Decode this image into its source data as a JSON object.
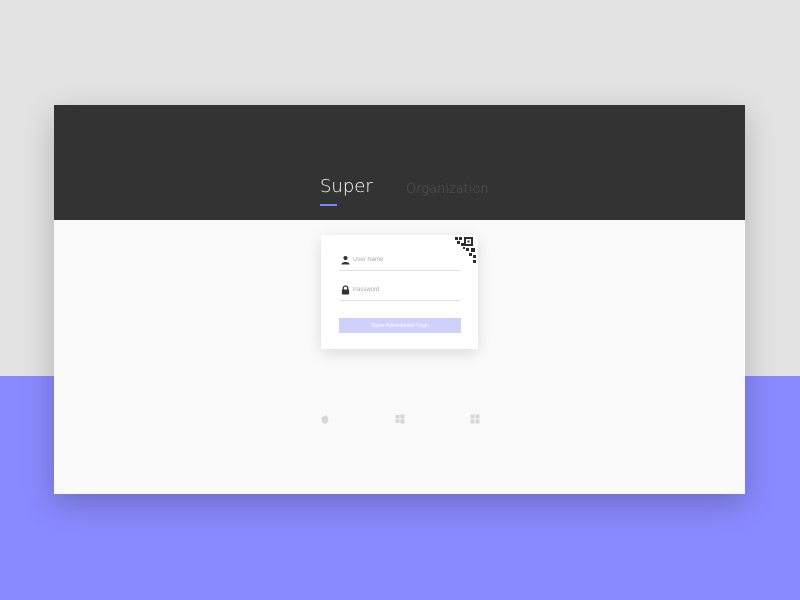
{
  "tabs": [
    {
      "label": "Super",
      "active": true
    },
    {
      "label": "Organization",
      "active": false
    }
  ],
  "login": {
    "username_placeholder": "User Name",
    "password_placeholder": "Password",
    "submit_label": "Super Administrator Login"
  },
  "icons": {
    "user": "user-icon",
    "password": "lock-icon",
    "qr": "qr-code-icon",
    "downloads": [
      "apple-icon",
      "windows-icon",
      "grid-app-icon"
    ]
  },
  "colors": {
    "header": "#333333",
    "accent": "#7b85ff",
    "page_lower": "#8a8aff",
    "button": "#cfd0fd"
  }
}
